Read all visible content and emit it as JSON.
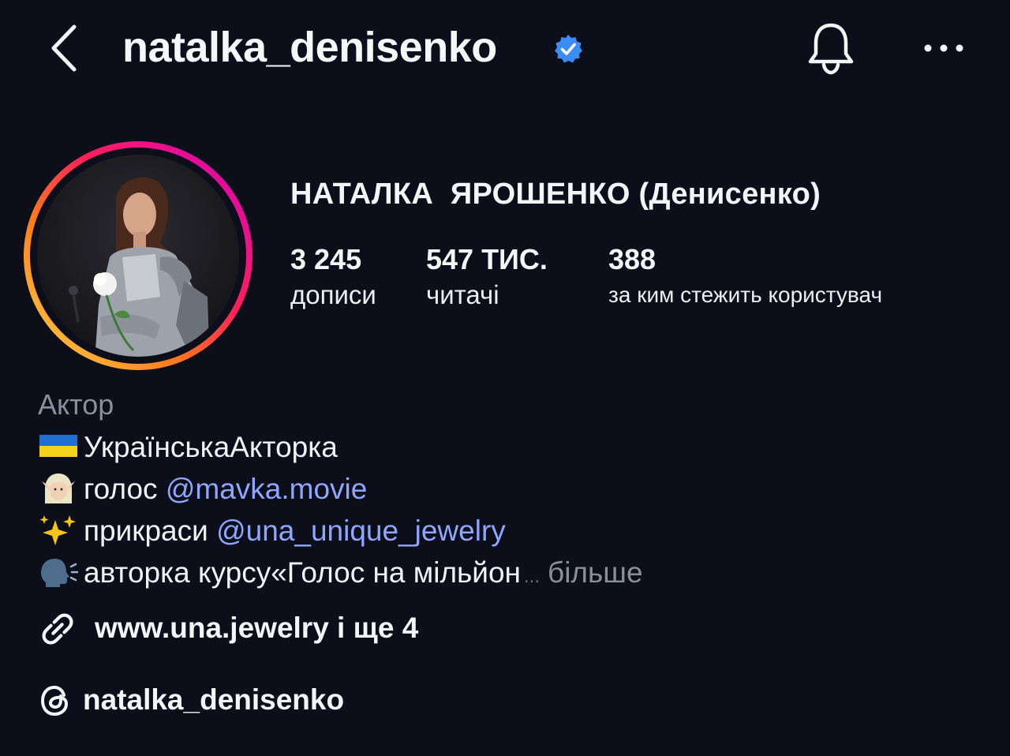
{
  "header": {
    "username": "natalka_denisenko",
    "verified": true
  },
  "profile": {
    "full_name": "НАТАЛКА  ЯРОШЕНКО (Денисенко)",
    "stats": [
      {
        "count": "3 245",
        "label": "дописи"
      },
      {
        "count": "547 ТИС.",
        "label": "читачі"
      },
      {
        "count": "388",
        "label": "за ким стежить користувач"
      }
    ]
  },
  "bio": {
    "category": "Актор",
    "lines": [
      {
        "text": "УкраїнськаАкторка"
      },
      {
        "text": "голос ",
        "mention": "@mavka.movie"
      },
      {
        "text": "прикраси ",
        "mention": "@una_unique_jewelry"
      },
      {
        "text": "авторка курсу«Голос на мільйон",
        "ellipsis": "...",
        "more": "більше"
      }
    ],
    "link": "www.una.jewelry і ще 4",
    "threads": "natalka_denisenko"
  },
  "colors": {
    "background": "#0c0f1a",
    "mention": "#8fa6ff",
    "verified": "#3b8cf6",
    "secondary_text": "#8a8f9b"
  },
  "icons": [
    "back-arrow-icon",
    "verified-badge-icon",
    "bell-icon",
    "more-dots-icon",
    "link-icon",
    "threads-icon",
    "ukraine-flag-icon",
    "elf-icon",
    "sparkles-icon",
    "speaking-head-icon"
  ]
}
